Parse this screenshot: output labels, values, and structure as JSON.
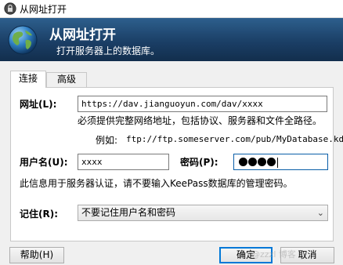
{
  "window": {
    "title": "从网址打开"
  },
  "banner": {
    "heading": "从网址打开",
    "subtitle": "打开服务器上的数据库。"
  },
  "tabs": [
    {
      "label": "连接"
    },
    {
      "label": "高级"
    }
  ],
  "url": {
    "label": "网址(L):",
    "value": "https://dav.jianguoyun.com/dav/xxxx",
    "hint": "必须提供完整网络地址，包括协议、服务器和文件全路径。",
    "example_prefix": "例如:",
    "example": "ftp://ftp.someserver.com/pub/MyDatabase.kdbx"
  },
  "user": {
    "label": "用户名(U):",
    "value": "xxxx"
  },
  "password": {
    "label": "密码(P):",
    "masked_length": 4
  },
  "info": "此信息用于服务器认证，请不要输入KeePass数据库的管理密码。",
  "remember": {
    "label": "记住(R):",
    "selected": "不要记住用户名和密码"
  },
  "buttons": {
    "help": "帮助(H)",
    "ok": "确定",
    "cancel": "取消"
  },
  "watermark": "@zzzl 博客"
}
